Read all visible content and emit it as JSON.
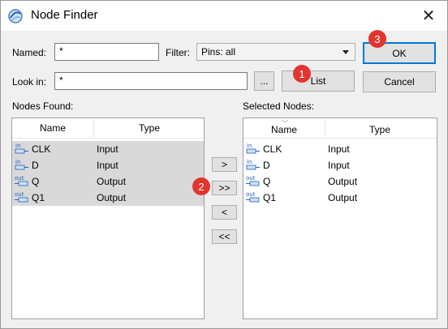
{
  "window": {
    "title": "Node Finder"
  },
  "named": {
    "label": "Named:",
    "value": "*"
  },
  "filter": {
    "label": "Filter:",
    "value": "Pins: all"
  },
  "look_in": {
    "label": "Look in:",
    "value": "*",
    "browse_label": "..."
  },
  "buttons": {
    "ok": "OK",
    "list": "List",
    "cancel": "Cancel"
  },
  "nodes_found": {
    "label": "Nodes Found:",
    "columns": [
      "Name",
      "Type"
    ],
    "rows": [
      {
        "icon": "in",
        "name": "CLK",
        "type": "Input"
      },
      {
        "icon": "in",
        "name": "D",
        "type": "Input"
      },
      {
        "icon": "out",
        "name": "Q",
        "type": "Output"
      },
      {
        "icon": "out",
        "name": "Q1",
        "type": "Output"
      }
    ]
  },
  "transfer": {
    "add_one": ">",
    "add_all": ">>",
    "remove_one": "<",
    "remove_all": "<<"
  },
  "selected_nodes": {
    "label": "Selected Nodes:",
    "columns": [
      "Name",
      "Type"
    ],
    "rows": [
      {
        "icon": "in",
        "name": "CLK",
        "type": "Input"
      },
      {
        "icon": "in",
        "name": "D",
        "type": "Input"
      },
      {
        "icon": "out",
        "name": "Q",
        "type": "Output"
      },
      {
        "icon": "out",
        "name": "Q1",
        "type": "Output"
      }
    ]
  },
  "annotations": [
    "1",
    "2",
    "3"
  ],
  "colors": {
    "default_border": "#0078d7",
    "badge": "#e3342f",
    "selection": "#d9d9d9",
    "pin_icon": "#1f5fbf"
  }
}
